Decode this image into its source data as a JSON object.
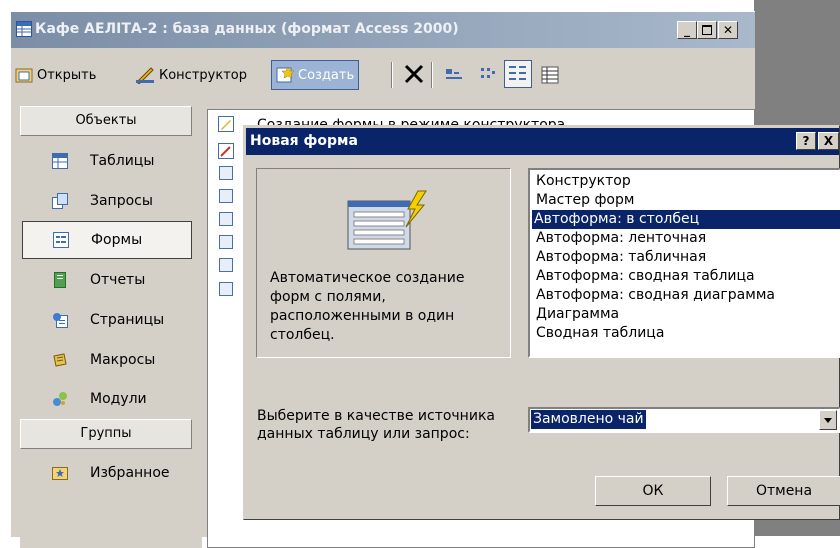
{
  "main_window": {
    "title": "Кафе АЕЛІТА-2 : база данных (формат Access 2000)"
  },
  "toolbar": {
    "open_label": "Открыть",
    "designer_label": "Конструктор",
    "create_label": "Создать"
  },
  "sidebar": {
    "objects_header": "Объекты",
    "items": [
      {
        "label": "Таблицы",
        "icon": "table-icon"
      },
      {
        "label": "Запросы",
        "icon": "query-icon"
      },
      {
        "label": "Формы",
        "icon": "form-icon",
        "selected": true
      },
      {
        "label": "Отчеты",
        "icon": "report-icon"
      },
      {
        "label": "Страницы",
        "icon": "page-icon"
      },
      {
        "label": "Макросы",
        "icon": "macro-icon"
      },
      {
        "label": "Модули",
        "icon": "module-icon"
      }
    ],
    "groups_header": "Группы",
    "group_items": [
      {
        "label": "Избранное",
        "icon": "favorites-icon"
      }
    ]
  },
  "list": {
    "first_item": "Создание формы в режиме конструктора"
  },
  "dialog": {
    "title": "Новая форма",
    "help_label": "?",
    "close_label": "X",
    "description": "Автоматическое создание форм с полями, расположенными в один столбец.",
    "types": [
      "Конструктор",
      "Мастер форм",
      "Автоформа: в столбец",
      "Автоформа: ленточная",
      "Автоформа: табличная",
      "Автоформа:  сводная таблица",
      "Автоформа:  сводная диаграмма",
      "Диаграмма",
      "Сводная таблица"
    ],
    "selected_type": "Автоформа: в столбец",
    "source_label": "Выберите в качестве источника данных таблицу или запрос:",
    "source_value": "Замовлено чай",
    "ok_label": "ОК",
    "cancel_label": "Отмена"
  },
  "colors": {
    "dialog_title_bg": "#0a246a",
    "selection_bg": "#0a246a",
    "chrome": "#d4d0c8",
    "inactive_title": "#7b8ea6"
  }
}
